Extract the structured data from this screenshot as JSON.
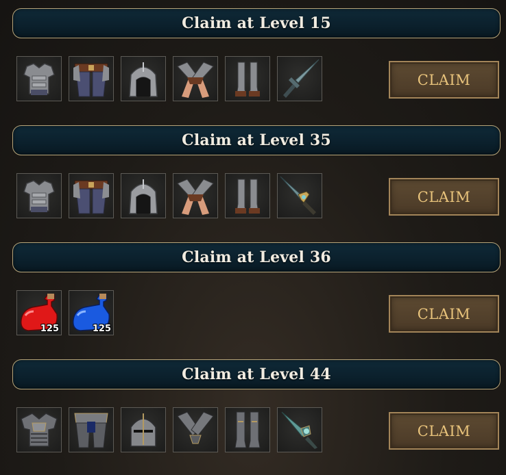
{
  "tiers": [
    {
      "title": "Claim at Level 15",
      "button": "CLAIM",
      "items": [
        "chest-armor-icon",
        "leg-armor-icon",
        "hood-helm-icon",
        "gauntlets-icon",
        "boots-icon",
        "curved-sword-icon"
      ]
    },
    {
      "title": "Claim at Level 35",
      "button": "CLAIM",
      "items": [
        "chest-armor-icon",
        "leg-armor-icon",
        "hood-helm-icon",
        "gauntlets-icon",
        "boots-icon",
        "ornate-sword-icon"
      ]
    },
    {
      "title": "Claim at Level 36",
      "button": "CLAIM",
      "items": [
        {
          "icon": "health-potion-icon",
          "quantity": "125"
        },
        {
          "icon": "mana-potion-icon",
          "quantity": "125"
        }
      ]
    },
    {
      "title": "Claim at Level 44",
      "button": "CLAIM",
      "items": [
        "plate-chest-armor-icon",
        "plate-leg-armor-icon",
        "knight-helm-icon",
        "plate-gauntlets-icon",
        "plate-boots-icon",
        "jade-blade-icon"
      ]
    }
  ],
  "colors": {
    "banner_bg": "#0b202c",
    "banner_border": "#b7a57a",
    "button_bg": "#4b3a27",
    "button_text": "#e9c47c",
    "health_potion": "#e01818",
    "mana_potion": "#1a5ae0"
  }
}
